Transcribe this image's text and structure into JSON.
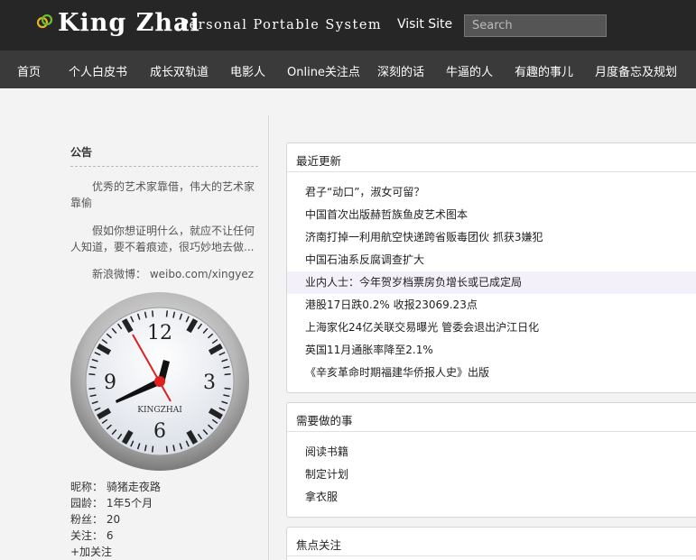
{
  "header": {
    "logo_title": "King Zhai",
    "logo_subtitle": "Personal Portable System",
    "visit_site": "Visit Site",
    "search_placeholder": "Search",
    "logo_icon": "rings-icon"
  },
  "nav": {
    "items": [
      "首页",
      "个人白皮书",
      "成长双轨道",
      "电影人",
      "Online关注点",
      "深刻的话",
      "牛逼的人",
      "有趣的事儿",
      "月度备忘及规划"
    ]
  },
  "sidebar": {
    "notice_title": "公告",
    "notice_p1": "优秀的艺术家靠借，伟大的艺术家靠偷",
    "notice_p2": "假如你想证明什么，就应不让任何人知道，要不着痕迹，很巧妙地去做...",
    "notice_p3": "新浪微博： weibo.com/xingyez",
    "clock_brand": "KINGZHAI",
    "clock_numerals": [
      "12",
      "3",
      "6",
      "9"
    ],
    "profile": {
      "nickname": "昵称： 骑猪走夜路",
      "age": "园龄： 1年5个月",
      "fans": "粉丝： 20",
      "follow": "关注： 6",
      "add_follow": "+加关注"
    }
  },
  "panels": {
    "recent": {
      "title": "最近更新",
      "items": [
        "君子“动口”，淑女可留？",
        "中国首次出版赫哲族鱼皮艺术图本",
        "济南打掉一利用航空快递跨省贩毒团伙 抓获3嫌犯",
        "中国石油系反腐调查扩大",
        "业内人士：今年贺岁档票房负增长或已成定局",
        "港股17日跌0.2% 收报23069.23点",
        "上海家化24亿关联交易曝光 管委会退出沪江日化",
        "英国11月通胀率降至2.1%",
        "《辛亥革命时期福建华侨报人史》出版"
      ]
    },
    "todo": {
      "title": "需要做的事",
      "items": [
        "阅读书籍",
        "制定计划",
        "拿衣服"
      ]
    },
    "focus": {
      "title": "焦点关注"
    }
  },
  "colors": {
    "topbar": "#262626",
    "navbar": "#3a3a3a",
    "highlight_row": "#f4f0fa",
    "second_hand": "#e0201f"
  }
}
